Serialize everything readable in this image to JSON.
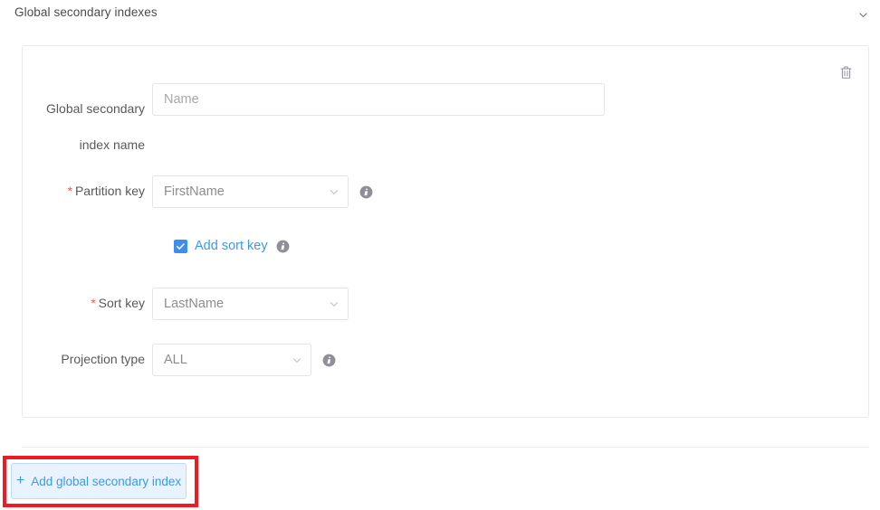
{
  "section": {
    "title": "Global secondary indexes",
    "collapse_icon": "chevron-down-icon"
  },
  "card": {
    "delete_icon": "trash-icon",
    "fields": {
      "index_name": {
        "label": "Global secondary\nindex name",
        "value": "",
        "placeholder": "Name",
        "required": false
      },
      "partition_key": {
        "label": "Partition key",
        "value": "FirstName",
        "required": true,
        "required_marker": "*",
        "info_icon": "info-icon",
        "caret_icon": "chevron-down-icon"
      },
      "add_sort_key": {
        "label": "Add sort key",
        "checked": true,
        "check_icon": "checkmark-icon",
        "info_icon": "info-icon"
      },
      "sort_key": {
        "label": "Sort key",
        "value": "LastName",
        "required": true,
        "required_marker": "*",
        "caret_icon": "chevron-down-icon"
      },
      "projection_type": {
        "label": "Projection type",
        "value": "ALL",
        "required": false,
        "info_icon": "info-icon",
        "caret_icon": "chevron-down-icon"
      }
    }
  },
  "footer": {
    "add_button": {
      "plus": "+",
      "label": "Add global secondary index"
    },
    "annotation": {
      "name": "highlight-rectangle",
      "color": "#ed1c24"
    }
  },
  "colors": {
    "accent_blue": "#3d9ae8",
    "checkbox_blue": "#3e8fec",
    "button_fill": "#e9f3fd",
    "button_border": "#bcdcfa",
    "required_red": "#f5594e",
    "annotation_red": "#ed1c24",
    "border_gray": "#e8e8ee",
    "label_gray": "#595959",
    "value_gray": "#8c8c92"
  }
}
